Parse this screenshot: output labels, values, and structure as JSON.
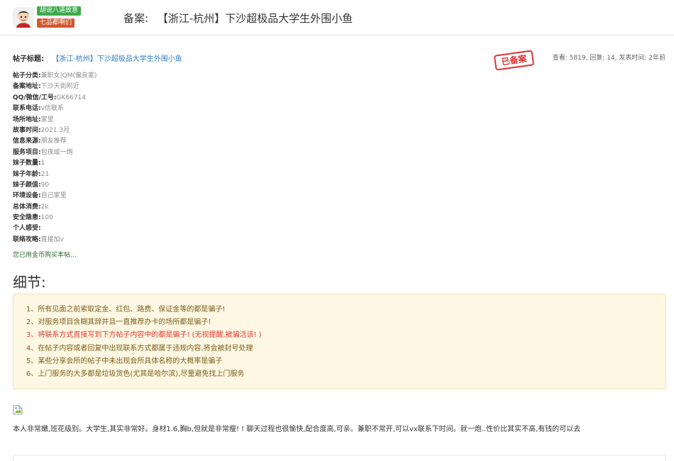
{
  "header": {
    "badges": [
      "胡说八道故意",
      "七品都啊们"
    ],
    "label": "备案:",
    "title": "【浙江-杭州】下沙超极品大学生外围小鱼"
  },
  "post": {
    "title_label": "帖子标题:",
    "title_link": "【浙江-杭州】下沙超极品大学生外围小鱼",
    "stamp": "已备案",
    "stats": "查看: 5819, 回复: 14, 发表时间: 2年前",
    "fields": [
      {
        "k": "帖子分类",
        "v": "兼职女|QM(偏良家)"
      },
      {
        "k": "备案地址",
        "v": "下沙天街附近"
      },
      {
        "k": "QQ/微信/工号",
        "v": "GK66714"
      },
      {
        "k": "联系电话",
        "v": "v信联系"
      },
      {
        "k": "场所地址",
        "v": "家里"
      },
      {
        "k": "故事时间",
        "v": "2021.3月"
      },
      {
        "k": "信息来源",
        "v": "朋友推荐"
      },
      {
        "k": "服务项目",
        "v": "包夜或一炮"
      },
      {
        "k": "妹子数量",
        "v": "1"
      },
      {
        "k": "妹子年龄",
        "v": "21"
      },
      {
        "k": "妹子颜值",
        "v": "90"
      },
      {
        "k": "环境设备",
        "v": "自己家里"
      },
      {
        "k": "总体消费",
        "v": "2k"
      },
      {
        "k": "安全隐患",
        "v": "100"
      },
      {
        "k": "个人感受",
        "v": ""
      },
      {
        "k": "联络攻略",
        "v": "直接加v"
      }
    ],
    "purchased": "您已用金币购买本帖..."
  },
  "details": {
    "title": "细节:",
    "notices": [
      "1、所有见面之前索取定金、红包、路费、保证金等的都是骗子!",
      "2、对服务项目含糊其辞并且一直推荐办卡的场所都是骗子!",
      "3、将联系方式直接写到下方帖子内容中的都是骗子! (无视提醒,被骗活该! )",
      "4、在帖子内容或者回复中出现联系方式都属于违规内容,将会被封号处理",
      "5、某些分享会所的帖子中未出现会所具体名称的大概率是骗子",
      "6、上门服务的大多都是垃圾货色(尤其是哈尔滨),尽量避免找上门服务"
    ],
    "highlight_index": 2
  },
  "content": {
    "text": "本人非常嫩,班花级别。大学生,其实非常好。身材1.6,胸b,但就是非常瘦! ! 聊天过程也很愉快,配合度高,可亲。兼职不常开,可以vx联系下时间。就一炮..性价比其实不高,有钱的可以去"
  },
  "colors": {
    "link": "#2a7cc7",
    "notice_bg": "#fdf7e3",
    "notice_text": "#7a5f1a",
    "warning": "#e53935",
    "badge_green": "#3aaa4a",
    "badge_orange": "#d2582c",
    "stamp": "#d33333"
  },
  "icons": {
    "avatar": "cartoon-avatar-icon",
    "broken_image": "broken-image-icon"
  }
}
